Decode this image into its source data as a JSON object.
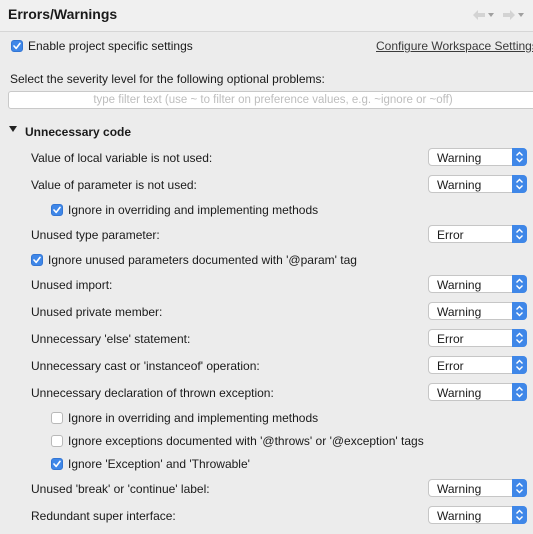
{
  "header": {
    "title": "Errors/Warnings"
  },
  "project_settings": {
    "enable_label": "Enable project specific settings",
    "configure_link": "Configure Workspace Settings..."
  },
  "filter": {
    "label": "Select the severity level for the following optional problems:",
    "placeholder": "type filter text (use ~ to filter on preference values, e.g. ~ignore or ~off)",
    "value": ""
  },
  "section": {
    "title": "Unnecessary code"
  },
  "options": [
    {
      "label": "Value of local variable is not used:",
      "value": "Warning"
    },
    {
      "label": "Value of parameter is not used:",
      "value": "Warning"
    },
    {
      "label": "Ignore in overriding and implementing methods",
      "checked": true
    },
    {
      "label": "Unused type parameter:",
      "value": "Error"
    },
    {
      "label": "Ignore unused parameters documented with '@param' tag",
      "checked": true
    },
    {
      "label": "Unused import:",
      "value": "Warning"
    },
    {
      "label": "Unused private member:",
      "value": "Warning"
    },
    {
      "label": "Unnecessary 'else' statement:",
      "value": "Error"
    },
    {
      "label": "Unnecessary cast or 'instanceof' operation:",
      "value": "Error"
    },
    {
      "label": "Unnecessary declaration of thrown exception:",
      "value": "Warning"
    },
    {
      "label": "Ignore in overriding and implementing methods",
      "checked": false
    },
    {
      "label": "Ignore exceptions documented with '@throws' or '@exception' tags",
      "checked": false
    },
    {
      "label": "Ignore 'Exception' and 'Throwable'",
      "checked": true
    },
    {
      "label": "Unused 'break' or 'continue' label:",
      "value": "Warning"
    },
    {
      "label": "Redundant super interface:",
      "value": "Warning"
    }
  ],
  "colors": {
    "accent": "#3f87e8",
    "background": "#ececec"
  }
}
